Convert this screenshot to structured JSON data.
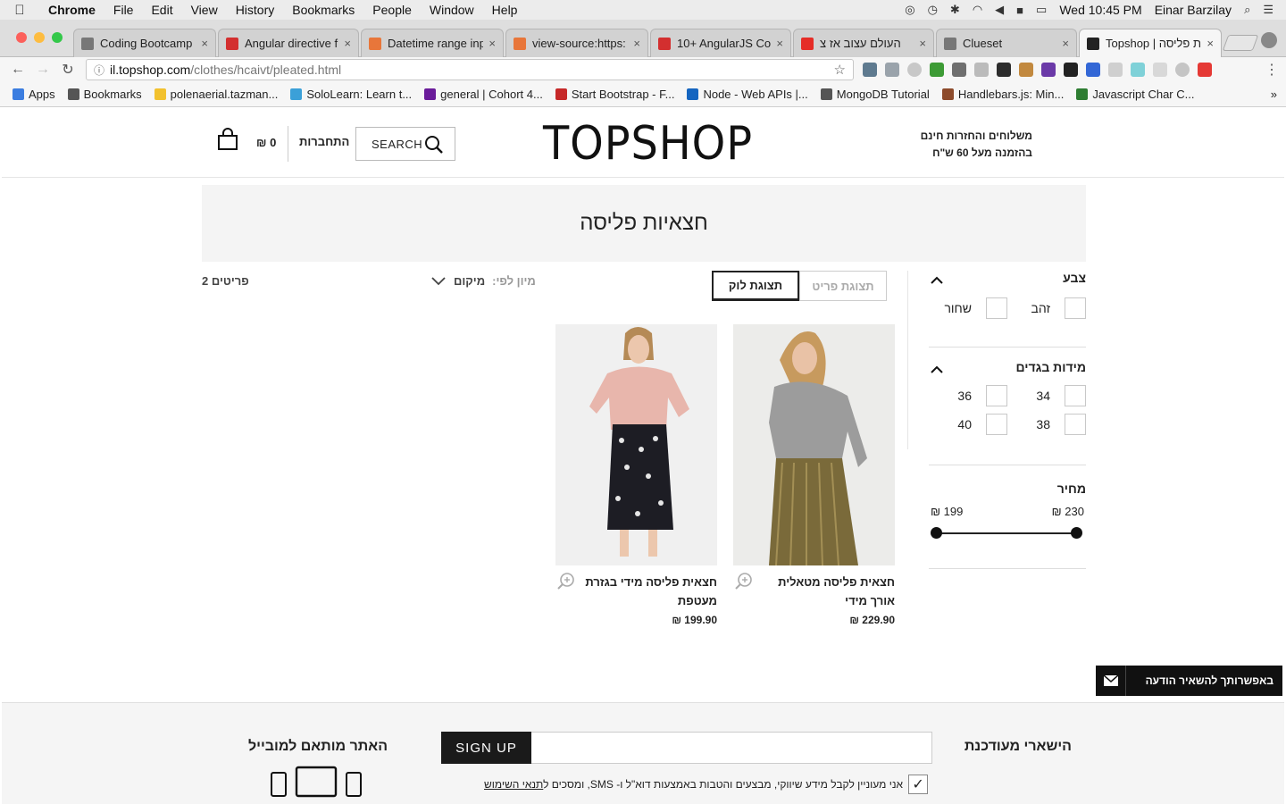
{
  "mac_menu": {
    "app": "Chrome",
    "items": [
      "File",
      "Edit",
      "View",
      "History",
      "Bookmarks",
      "People",
      "Window",
      "Help"
    ],
    "clock": "Wed 10:45 PM",
    "user": "Einar Barzilay"
  },
  "tabs": [
    {
      "title": "Coding Bootcamp",
      "icon_color": "#777777",
      "icon": "page-icon"
    },
    {
      "title": "Angular directive f",
      "icon_color": "#d32f2f",
      "icon": "angular-icon"
    },
    {
      "title": "Datetime range inp",
      "icon_color": "#e8763a",
      "icon": "stackoverflow-icon"
    },
    {
      "title": "view-source:https:",
      "icon_color": "#e8763a",
      "icon": "stackoverflow-icon"
    },
    {
      "title": "10+ AngularJS Co",
      "icon_color": "#d32f2f",
      "icon": "angular-icon"
    },
    {
      "title": "העולם עצוב אז צ",
      "icon_color": "#e52d27",
      "icon": "youtube-icon"
    },
    {
      "title": "Clueset",
      "icon_color": "#777777",
      "icon": "page-icon"
    },
    {
      "title": "Topshop | ות פליסה",
      "icon_color": "#222222",
      "icon": "topshop-icon"
    }
  ],
  "address": {
    "host": "il.topshop.com",
    "path": "/clothes/hcaivt/pleated.html"
  },
  "bookmarks": [
    {
      "label": "Apps",
      "icon_color": "#3b7de0"
    },
    {
      "label": "Bookmarks",
      "icon_color": "#555555"
    },
    {
      "label": "polenaerial.tazman...",
      "icon_color": "#f2c12e"
    },
    {
      "label": "SoloLearn: Learn t...",
      "icon_color": "#3ba0d8"
    },
    {
      "label": "general | Cohort 4...",
      "icon_color": "#6a1b9a"
    },
    {
      "label": "Start Bootstrap - F...",
      "icon_color": "#c62828"
    },
    {
      "label": "Node - Web APIs |...",
      "icon_color": "#1565c0"
    },
    {
      "label": "MongoDB Tutorial",
      "icon_color": "#555555"
    },
    {
      "label": "Handlebars.js: Min...",
      "icon_color": "#8d4b2b"
    },
    {
      "label": "Javascript Char C...",
      "icon_color": "#2e7d32"
    }
  ],
  "header": {
    "bag_amount": "₪ 0",
    "login": "התחברות",
    "search_label": "SEARCH",
    "logo": "TOPSHOP",
    "shipping_line1": "משלוחים והחזרות חינם",
    "shipping_line2": "בהזמנה מעל 60 ש\"ח"
  },
  "category": {
    "title": "חצאיות פליסה"
  },
  "toolbar": {
    "count": "2 פריטים",
    "sort_label": "מיון לפי:",
    "sort_value": "מיקום",
    "view_item": "תצוגת פריט",
    "view_look": "תצוגת לוק"
  },
  "filters": {
    "color_title": "צבע",
    "colors": [
      "זהב",
      "שחור"
    ],
    "size_title": "מידות בגדים",
    "sizes": [
      "34",
      "36",
      "38",
      "40"
    ],
    "price_title": "מחיר",
    "price_max": "230 ₪",
    "price_min": "199 ₪"
  },
  "products": [
    {
      "name": "חצאית פליסה מטאלית אורך מידי",
      "price": "229.90 ₪"
    },
    {
      "name": "חצאית פליסה מידי בגזרת מעטפת",
      "price": "199.90 ₪"
    }
  ],
  "footer": {
    "stay_updated": "הישארי מעודכנת",
    "signup": "SIGN UP",
    "consent": "אני מעוניין לקבל מידע שיווקי, מבצעים והטבות באמצעות דוא\"ל ו- SMS, ומסכים ל",
    "terms": "תנאי השימוש",
    "mobile_title": "האתר מותאם למובייל",
    "chat": "באפשרותך להשאיר הודעה"
  }
}
